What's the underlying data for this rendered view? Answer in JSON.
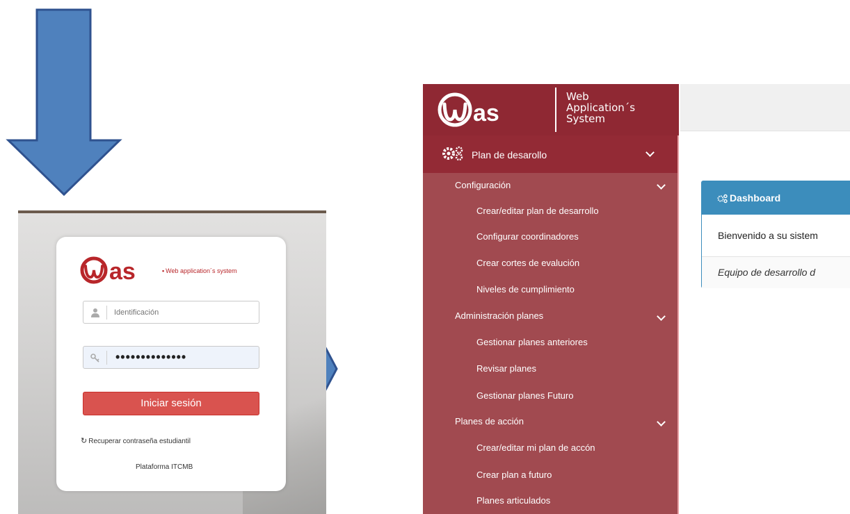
{
  "colors": {
    "arrow_fill": "#4f81bd",
    "arrow_border": "#2f528f",
    "brand_red": "#b8262a",
    "sidebar": "#a14a50",
    "dashboard_blue": "#3c8dbc"
  },
  "login": {
    "logo_text": "as",
    "tagline": "Web application´s system",
    "id_placeholder": "Identificación",
    "password_mask": "••••••••••••••",
    "submit_label": "Iniciar sesión",
    "recover_link": "Recuperar contraseña estudiantil",
    "platform_label": "Plataforma ITCMB"
  },
  "app": {
    "logo_text": "as",
    "logo_tagline_lines": [
      "Web",
      "Application´s",
      "System"
    ],
    "menu": {
      "header": "Plan de desarollo",
      "groups": [
        {
          "title": "Configuración",
          "items": [
            "Crear/editar plan de desarrollo",
            "Configurar coordinadores",
            "Crear cortes de evalución",
            "Niveles de cumplimiento"
          ]
        },
        {
          "title": "Administración planes",
          "items": [
            "Gestionar planes anteriores",
            "Revisar planes",
            "Gestionar planes Futuro"
          ]
        },
        {
          "title": "Planes de acción",
          "items": [
            "Crear/editar mi plan de accón",
            "Crear plan a futuro",
            "Planes articulados"
          ]
        }
      ]
    },
    "dashboard": {
      "title": "Dashboard",
      "welcome": "Bienvenido a su sistem",
      "footer": "Equipo de desarrollo d"
    }
  }
}
